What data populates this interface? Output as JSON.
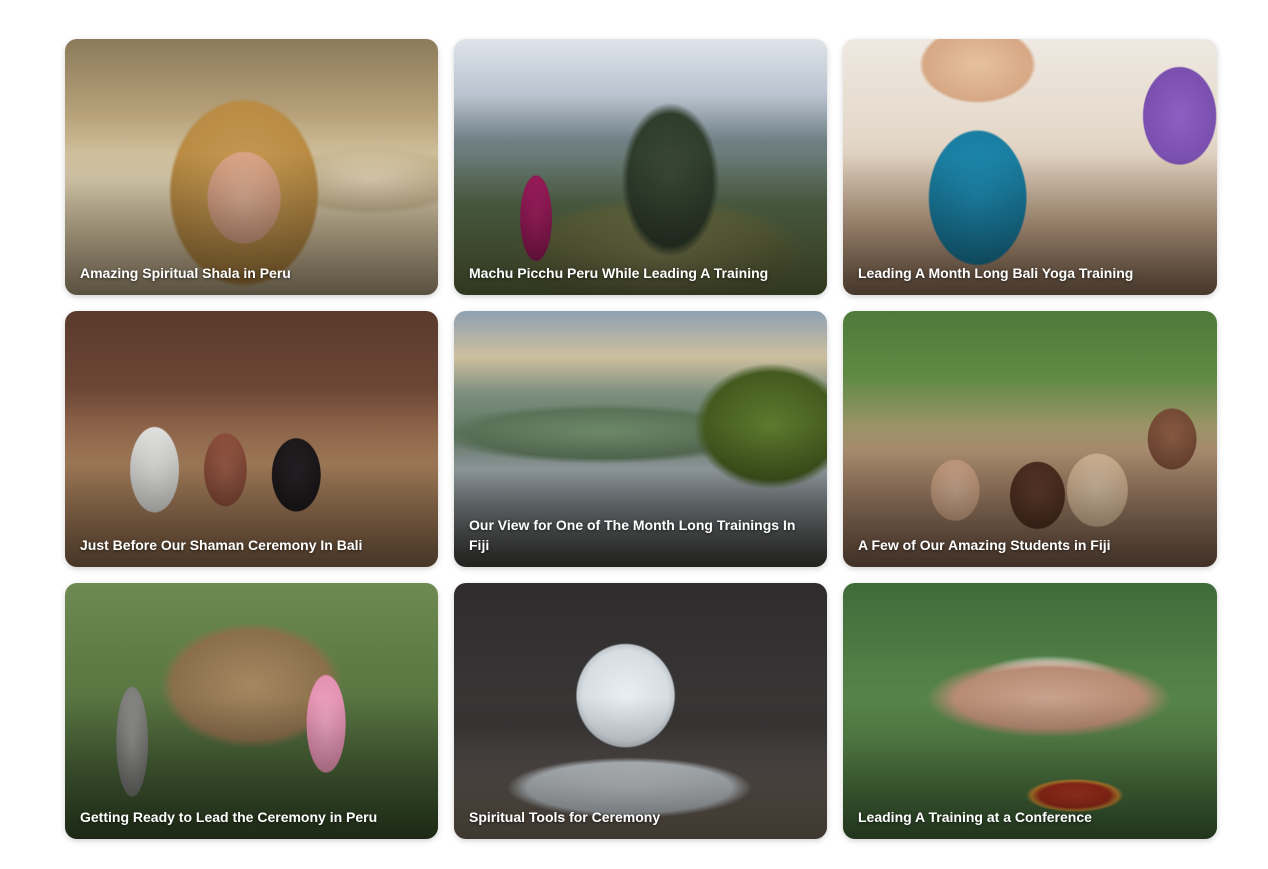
{
  "gallery": {
    "items": [
      {
        "caption": "Amazing Spiritual Shala in Peru"
      },
      {
        "caption": "Machu Picchu Peru While Leading A Training"
      },
      {
        "caption": "Leading A Month Long Bali Yoga Training"
      },
      {
        "caption": "Just Before Our Shaman Ceremony In Bali"
      },
      {
        "caption": "Our View for One of The Month Long Trainings In Fiji"
      },
      {
        "caption": "A Few of Our Amazing Students in Fiji"
      },
      {
        "caption": "Getting Ready to Lead the Ceremony in Peru"
      },
      {
        "caption": "Spiritual Tools for Ceremony"
      },
      {
        "caption": "Leading A Training at a Conference"
      }
    ]
  }
}
